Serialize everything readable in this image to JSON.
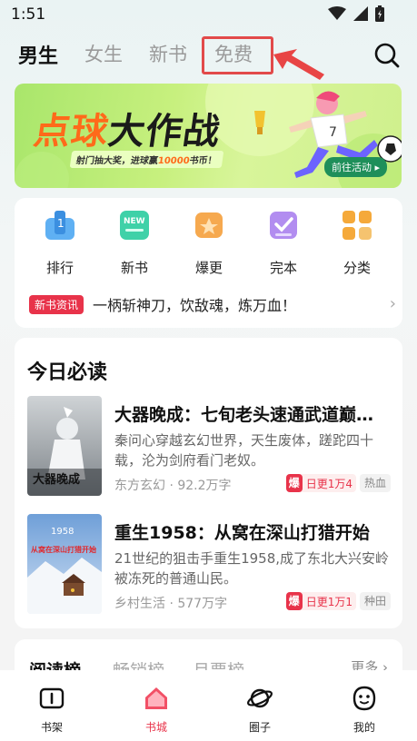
{
  "status": {
    "time": "1:51"
  },
  "top_tabs": [
    {
      "label": "男生"
    },
    {
      "label": "女生"
    },
    {
      "label": "新书"
    },
    {
      "label": "免费"
    }
  ],
  "banner": {
    "title_part1": "点球",
    "title_part2": "大作战",
    "subtitle_pre": "射门抽大奖，进球赢",
    "subtitle_num": "10000",
    "subtitle_post": "书币！",
    "button": "前往活动 ▸",
    "jersey_number": "7"
  },
  "categories": [
    {
      "label": "排行",
      "icon": "ranking-icon",
      "color": "#4aa3f0"
    },
    {
      "label": "新书",
      "icon": "new-book-icon",
      "color": "#3fc9a0",
      "badge": "NEW"
    },
    {
      "label": "爆更",
      "icon": "hot-update-icon",
      "color": "#f0a24a"
    },
    {
      "label": "完本",
      "icon": "finished-icon",
      "color": "#a77ee8"
    },
    {
      "label": "分类",
      "icon": "category-grid-icon",
      "color": "#f5a93a"
    }
  ],
  "news": {
    "badge": "新书资讯",
    "text": "一柄斩神刀，饮敌魂，炼万血！"
  },
  "must_read": {
    "title": "今日必读",
    "books": [
      {
        "title": "大器晚成：七旬老头速通武道巅…",
        "desc": "秦问心穿越玄幻世界，天生废体，蹉跎四十载，沦为剑府看门老奴。",
        "meta": "东方玄幻 · 92.2万字",
        "hot_badge": "爆",
        "hot_text": "日更1万4",
        "tag": "热血",
        "cover_text": "大器晚成"
      },
      {
        "title": "重生1958：从窝在深山打猎开始",
        "desc": "21世纪的狙击手重生1958,成了东北大兴安岭被冻死的普通山民。",
        "meta": "乡村生活 · 577万字",
        "hot_badge": "爆",
        "hot_text": "日更1万1",
        "tag": "种田",
        "cover_text": "从窝在深山打猎开始",
        "cover_year": "1958"
      }
    ]
  },
  "rank": {
    "tabs": [
      "阅读榜",
      "畅销榜",
      "月票榜"
    ],
    "more": "更多 ›"
  },
  "bottom_nav": [
    {
      "label": "书架",
      "icon": "bookshelf-icon"
    },
    {
      "label": "书城",
      "icon": "bookstore-icon"
    },
    {
      "label": "圈子",
      "icon": "planet-icon"
    },
    {
      "label": "我的",
      "icon": "profile-icon"
    }
  ],
  "colors": {
    "accent": "#e8334a",
    "highlight_box": "#e24a4a"
  }
}
